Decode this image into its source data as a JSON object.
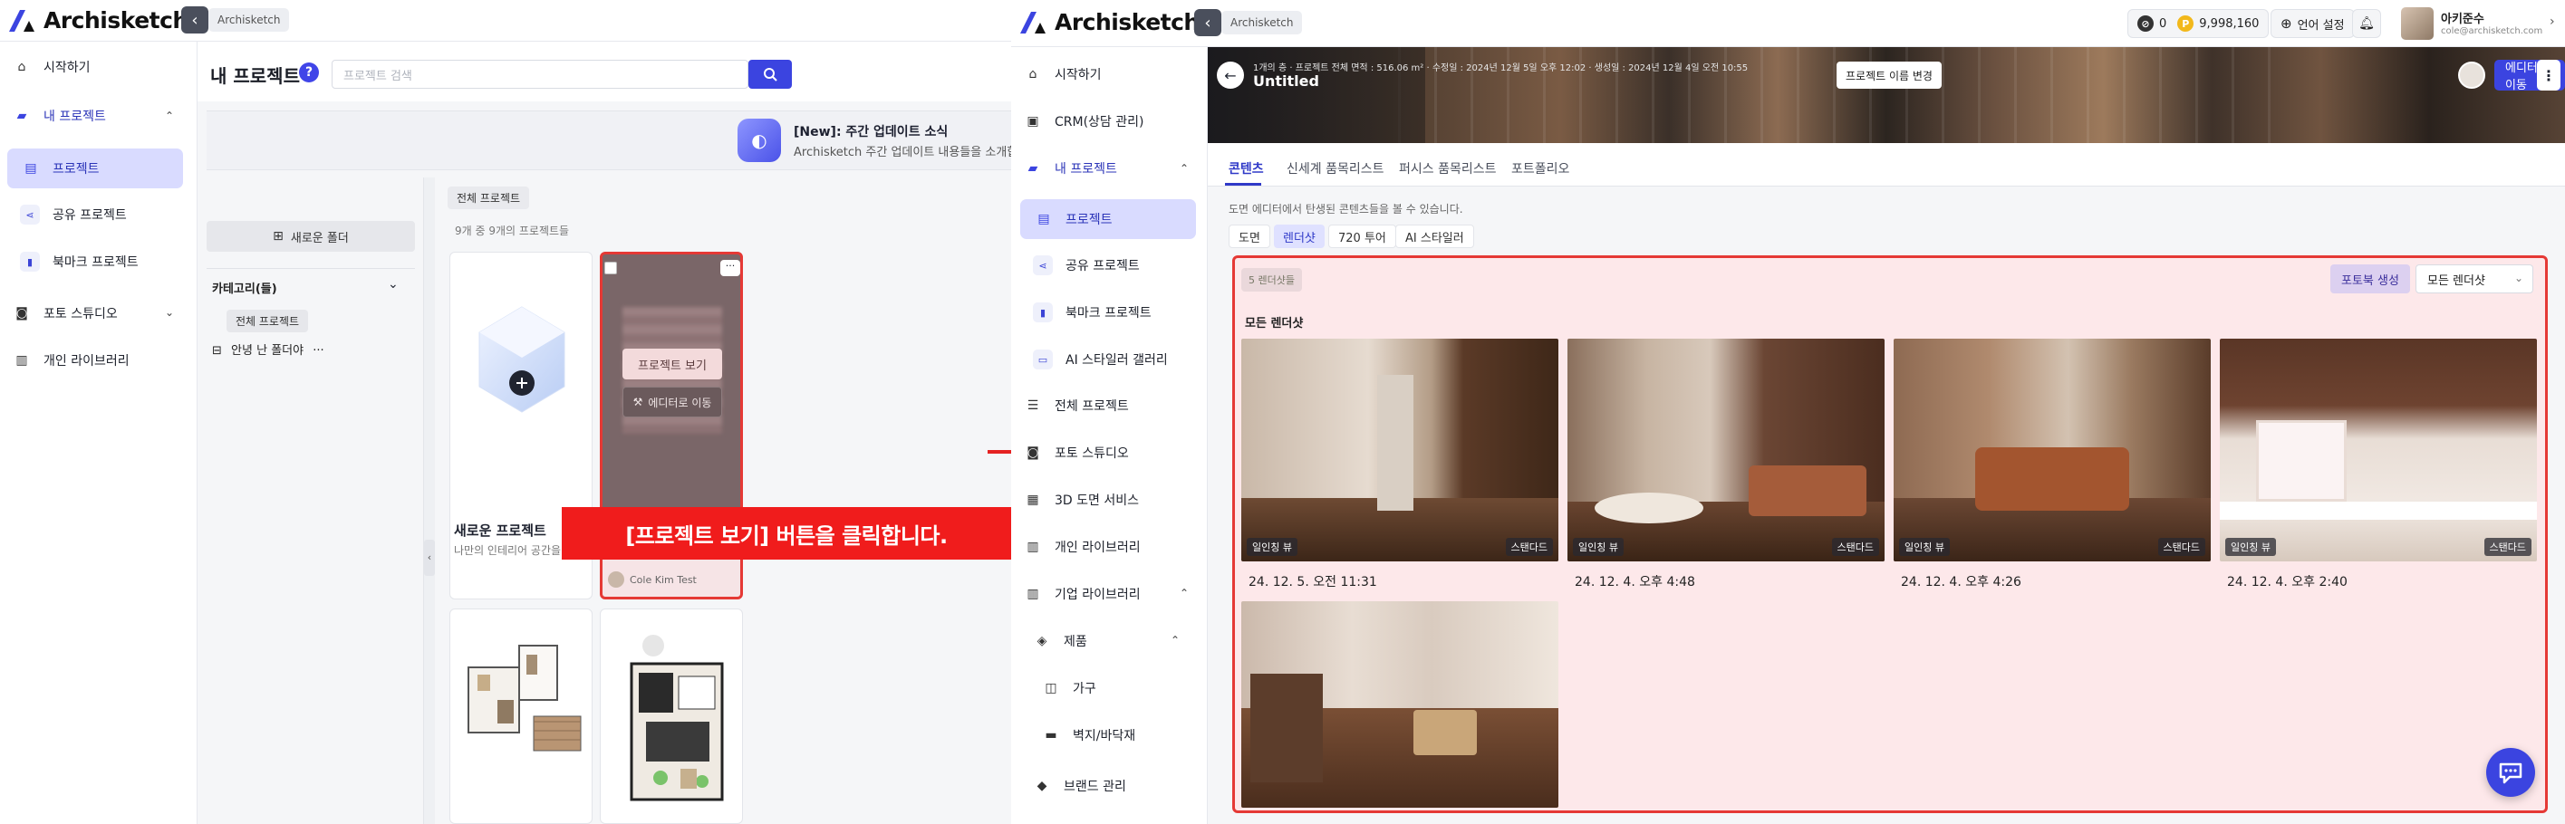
{
  "left_screen": {
    "brand": "Archisketch",
    "breadcrumb": "Archisketch",
    "sidebar": {
      "start": "시작하기",
      "my_projects": "내 프로젝트",
      "projects": "프로젝트",
      "shared_projects": "공유 프로젝트",
      "bookmark_projects": "북마크 프로젝트",
      "photo_studio": "포토 스튜디오",
      "personal_library": "개인 라이브러리"
    },
    "page_title": "내 프로젝트",
    "help": "?",
    "search_placeholder": "프로젝트 검색",
    "banner": {
      "title": "[New]: 주간 업데이트 소식",
      "subtitle": "Archisketch 주간 업데이트 내용들을 소개합니"
    },
    "folder_panel": {
      "new_folder": "새로운 폴더",
      "category": "카테고리(들)",
      "all_projects": "전체 프로젝트",
      "unnamed_folder": "안녕 난 폴더야",
      "more": "···"
    },
    "content": {
      "crumb": "전체 프로젝트",
      "count": "9개 중 9개의 프로젝트들"
    },
    "new_project_card": {
      "title": "새로운 프로젝트",
      "subtitle": "나만의 인테리어 공간을 만들어보세요"
    },
    "hover_card": {
      "view_button": "프로젝트 보기",
      "editor_button": "에디터로 이동",
      "owner": "Cole Kim Test",
      "more": "···"
    }
  },
  "callout": "[프로젝트 보기] 버튼을 클릭합니다.",
  "right_screen": {
    "brand": "Archisketch",
    "breadcrumb": "Archisketch",
    "coins": {
      "silver": "0",
      "gold": "9,998,160"
    },
    "language": "언어 설정",
    "user": {
      "name": "아키준수",
      "email": "cole@archisketch.com"
    },
    "sidebar": {
      "start": "시작하기",
      "crm": "CRM(상담 관리)",
      "my_projects": "내 프로젝트",
      "projects": "프로젝트",
      "shared_projects": "공유 프로젝트",
      "bookmark_projects": "북마크 프로젝트",
      "ai_gallery": "AI 스타일러 갤러리",
      "all_projects": "전체 프로젝트",
      "photo_studio": "포토 스튜디오",
      "floorplan_service": "3D 도면 서비스",
      "personal_library": "개인 라이브러리",
      "company_library": "기업 라이브러리",
      "products": "제품",
      "furniture": "가구",
      "wall_floor": "벽지/바닥재",
      "brand_manage": "브랜드 관리"
    },
    "project": {
      "meta": "1개의 층 · 프로젝트 전체 면적 : 516.06 m² · 수정일 : 2024년 12월 5일 오후 12:02 · 생성일 : 2024년 12월 4일 오전 10:55",
      "title": "Untitled",
      "rename_button": "프로젝트 이름 변경",
      "editor_button": "에디터로 이동"
    },
    "tabs": [
      "콘텐츠",
      "신세계 품목리스트",
      "퍼시스 품목리스트",
      "포트폴리오"
    ],
    "content_desc": "도면 에디터에서 탄생된 콘텐츠들을 볼 수 있습니다.",
    "subtabs": [
      "도면",
      "렌더샷",
      "720 투어",
      "AI 스타일러"
    ],
    "render_panel": {
      "count_chip": "5 렌더샷들",
      "photobook_button": "포토북 생성",
      "filter_value": "모든 렌더샷",
      "section_title": "모든 렌더샷",
      "photos": [
        {
          "view": "일인칭 뷰",
          "quality": "스탠다드",
          "date": "24. 12. 5. 오전 11:31"
        },
        {
          "view": "일인칭 뷰",
          "quality": "스탠다드",
          "date": "24. 12. 4. 오후 4:48"
        },
        {
          "view": "일인칭 뷰",
          "quality": "스탠다드",
          "date": "24. 12. 4. 오후 4:26"
        },
        {
          "view": "일인칭 뷰",
          "quality": "스탠다드",
          "date": "24. 12. 4. 오후 2:40"
        },
        {
          "view": "",
          "quality": "",
          "date": ""
        }
      ]
    }
  },
  "colors": {
    "accent": "#3b44e0",
    "highlight_red": "#e53935",
    "active_nav_bg": "#d9dbff"
  }
}
